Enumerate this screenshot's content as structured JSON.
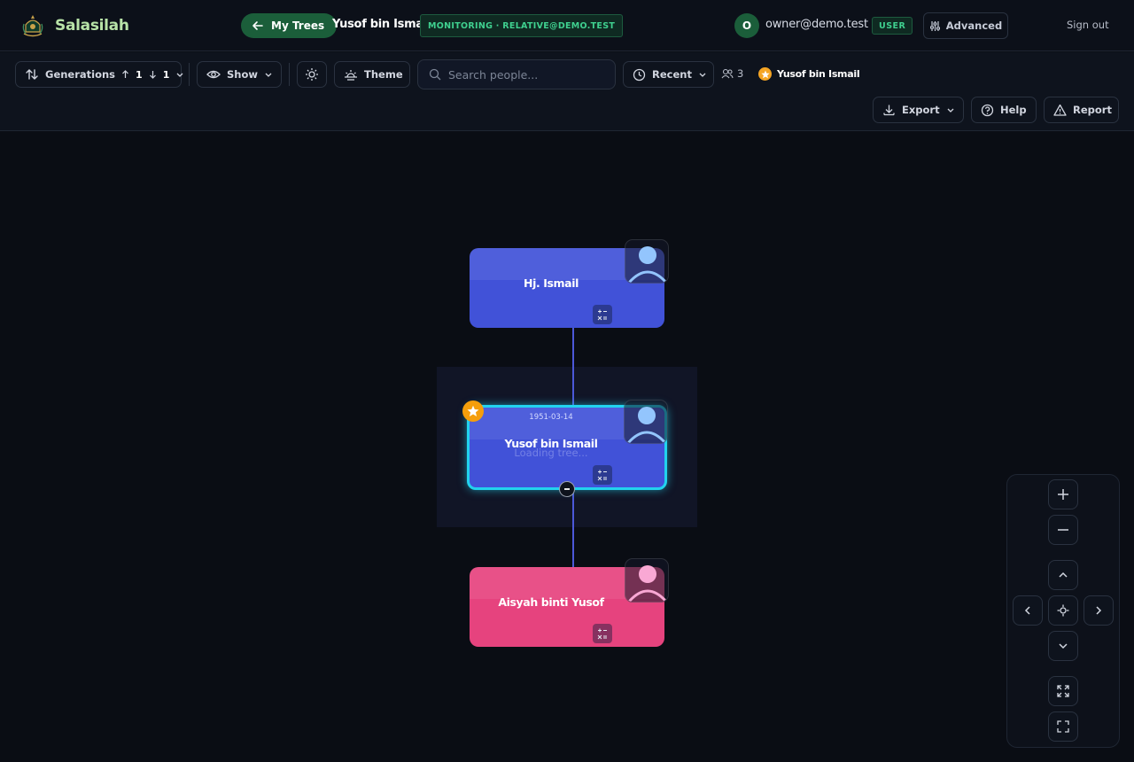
{
  "app": {
    "name": "Salasilah"
  },
  "header": {
    "back_label": "My Trees",
    "tree_title": "Yusof bin Ismail",
    "monitoring_badge": "MONITORING · RELATIVE@DEMO.TEST",
    "user_initial": "O",
    "user_email": "owner@demo.test",
    "role_badge": "USER",
    "advanced_label": "Advanced",
    "signout_label": "Sign out"
  },
  "toolbar": {
    "generations_label": "Generations",
    "generations_up": "1",
    "generations_down": "1",
    "show_label": "Show",
    "theme_label": "Theme",
    "search_placeholder": "Search people...",
    "recent_label": "Recent",
    "people_count": "3",
    "focus_person": "Yusof bin Ismail",
    "export_label": "Export",
    "help_label": "Help",
    "report_label": "Report"
  },
  "tree": {
    "nodes": [
      {
        "name": "Hj. Ismail",
        "gender": "male",
        "date": ""
      },
      {
        "name": "Yusof bin Ismail",
        "gender": "male",
        "date": "1951-03-14",
        "selected": true,
        "overlay_text": "Loading tree..."
      },
      {
        "name": "Aisyah binti Yusof",
        "gender": "female",
        "date": ""
      }
    ]
  },
  "colors": {
    "male_card": "#4152d8",
    "female_card": "#e6437e",
    "selection": "#22d3ee",
    "accent_green": "#1b5e3a",
    "star": "#f59e0b"
  }
}
